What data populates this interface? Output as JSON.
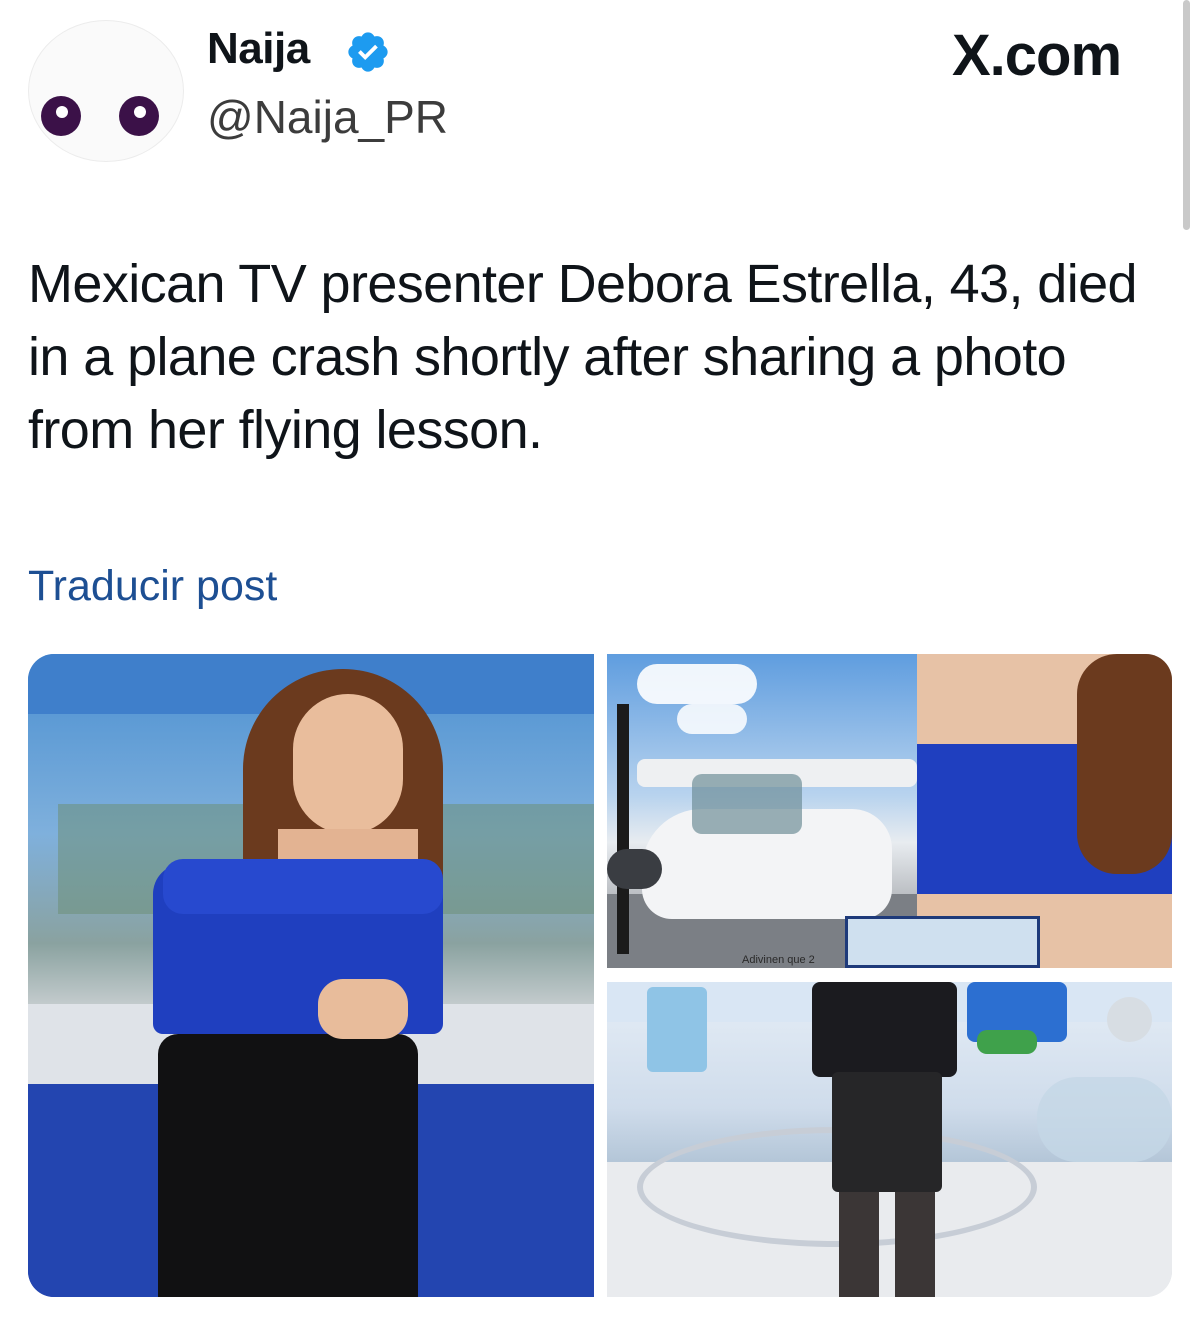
{
  "account": {
    "display_name": "Naija",
    "handle": "@Naija_PR",
    "verified": true,
    "avatar_icon": "eyes-emoji-avatar"
  },
  "brand": {
    "label": "X.com"
  },
  "post": {
    "text": "Mexican TV presenter Debora Estrella, 43, died in a plane crash shortly after sharing a photo from her flying lesson.",
    "translate_label": "Traducir post"
  },
  "media": {
    "count": 3,
    "overlay_caption": "Adivinen que 2"
  },
  "colors": {
    "link": "#1d4f93",
    "verified_badge": "#1d9bf0",
    "text": "#0f1419",
    "avatar_eyes": "#3b1148"
  }
}
